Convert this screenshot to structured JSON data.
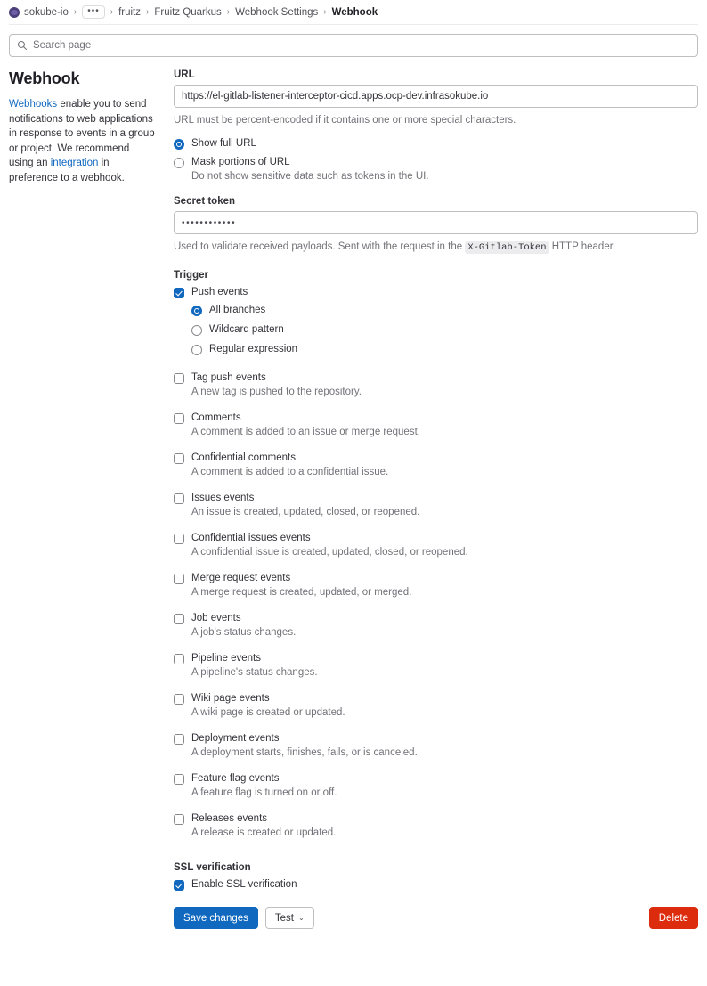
{
  "breadcrumb": {
    "avatar_name": "sokube-io-avatar",
    "items": [
      {
        "label": "sokube-io",
        "type": "link"
      },
      {
        "label": "•••",
        "type": "more"
      },
      {
        "label": "fruitz",
        "type": "link"
      },
      {
        "label": "Fruitz Quarkus",
        "type": "link"
      },
      {
        "label": "Webhook Settings",
        "type": "link"
      },
      {
        "label": "Webhook",
        "type": "current"
      }
    ],
    "separator": "›"
  },
  "search": {
    "placeholder": "Search page",
    "icon": "search-icon"
  },
  "sidebar": {
    "title": "Webhook",
    "description_link_1": "Webhooks",
    "description_part_1": " enable you to send notifications to web applications in response to events in a group or project. We recommend using an ",
    "description_link_2": "integration",
    "description_part_2": " in preference to a webhook."
  },
  "form": {
    "url": {
      "label": "URL",
      "value": "https://el-gitlab-listener-interceptor-cicd.apps.ocp-dev.infrasokube.io",
      "help": "URL must be percent-encoded if it contains one or more special characters."
    },
    "url_display_options": [
      {
        "label": "Show full URL",
        "selected": true,
        "desc": ""
      },
      {
        "label": "Mask portions of URL",
        "selected": false,
        "desc": "Do not show sensitive data such as tokens in the UI."
      }
    ],
    "secret_token": {
      "label": "Secret token",
      "value": "••••••••••••",
      "help_before": "Used to validate received payloads. Sent with the request in the ",
      "help_code": "X-Gitlab-Token",
      "help_after": " HTTP header."
    },
    "trigger": {
      "title": "Trigger",
      "push_events": {
        "label": "Push events",
        "checked": true
      },
      "push_branch_options": [
        {
          "label": "All branches",
          "selected": true
        },
        {
          "label": "Wildcard pattern",
          "selected": false
        },
        {
          "label": "Regular expression",
          "selected": false
        }
      ],
      "events": [
        {
          "label": "Tag push events",
          "desc": "A new tag is pushed to the repository.",
          "checked": false
        },
        {
          "label": "Comments",
          "desc": "A comment is added to an issue or merge request.",
          "checked": false
        },
        {
          "label": "Confidential comments",
          "desc": "A comment is added to a confidential issue.",
          "checked": false
        },
        {
          "label": "Issues events",
          "desc": "An issue is created, updated, closed, or reopened.",
          "checked": false
        },
        {
          "label": "Confidential issues events",
          "desc": "A confidential issue is created, updated, closed, or reopened.",
          "checked": false
        },
        {
          "label": "Merge request events",
          "desc": "A merge request is created, updated, or merged.",
          "checked": false
        },
        {
          "label": "Job events",
          "desc": "A job's status changes.",
          "checked": false
        },
        {
          "label": "Pipeline events",
          "desc": "A pipeline's status changes.",
          "checked": false
        },
        {
          "label": "Wiki page events",
          "desc": "A wiki page is created or updated.",
          "checked": false
        },
        {
          "label": "Deployment events",
          "desc": "A deployment starts, finishes, fails, or is canceled.",
          "checked": false
        },
        {
          "label": "Feature flag events",
          "desc": "A feature flag is turned on or off.",
          "checked": false
        },
        {
          "label": "Releases events",
          "desc": "A release is created or updated.",
          "checked": false
        }
      ]
    },
    "ssl": {
      "title": "SSL verification",
      "label": "Enable SSL verification",
      "checked": true
    },
    "actions": {
      "save": "Save changes",
      "test": "Test",
      "test_caret": "⌄",
      "delete": "Delete"
    }
  },
  "colors": {
    "primary": "#1068bf",
    "danger": "#dd2b0e",
    "link": "#1068bf",
    "text": "#333238",
    "muted": "#737278"
  }
}
